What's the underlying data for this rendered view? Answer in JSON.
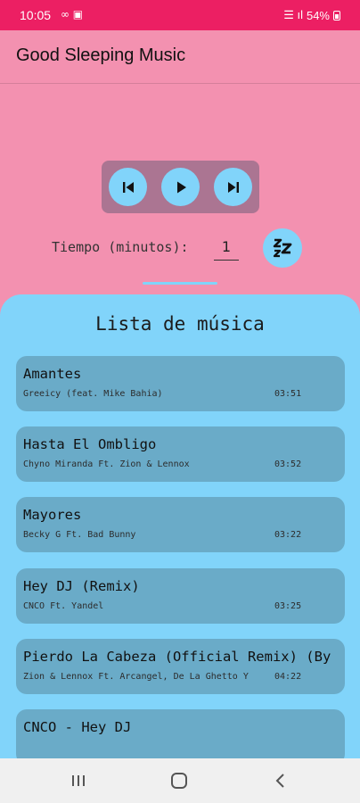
{
  "status_bar": {
    "time": "10:05",
    "left_icons": "∞ ▣",
    "signal": "☰ ıl",
    "battery": "54%"
  },
  "app_bar": {
    "title": "Good Sleeping Music"
  },
  "player": {
    "prev_icon": "skip-previous-icon",
    "play_icon": "play-icon",
    "next_icon": "skip-next-icon"
  },
  "timer": {
    "label": "Tiempo (minutos):",
    "value": "1",
    "sleep_icon": "zzz-icon"
  },
  "playlist": {
    "title": "Lista de música",
    "songs": [
      {
        "title": "Amantes",
        "artist": "Greeicy (feat. Mike Bahia)",
        "duration": "03:51"
      },
      {
        "title": "Hasta El Ombligo",
        "artist": "Chyno Miranda Ft. Zion & Lennox",
        "duration": "03:52"
      },
      {
        "title": "Mayores",
        "artist": "Becky G Ft. Bad Bunny",
        "duration": "03:22"
      },
      {
        "title": "Hey DJ (Remix)",
        "artist": "CNCO Ft. Yandel",
        "duration": "03:25"
      },
      {
        "title": "Pierdo La Cabeza (Official Remix) (By",
        "artist": "Zion & Lennox Ft. Arcangel, De La Ghetto Y",
        "duration": "04:22"
      },
      {
        "title": "CNCO - Hey DJ",
        "artist": "",
        "duration": ""
      }
    ]
  },
  "nav": {
    "recents_icon": "recents-icon",
    "home_icon": "home-icon",
    "back_icon": "back-icon"
  }
}
